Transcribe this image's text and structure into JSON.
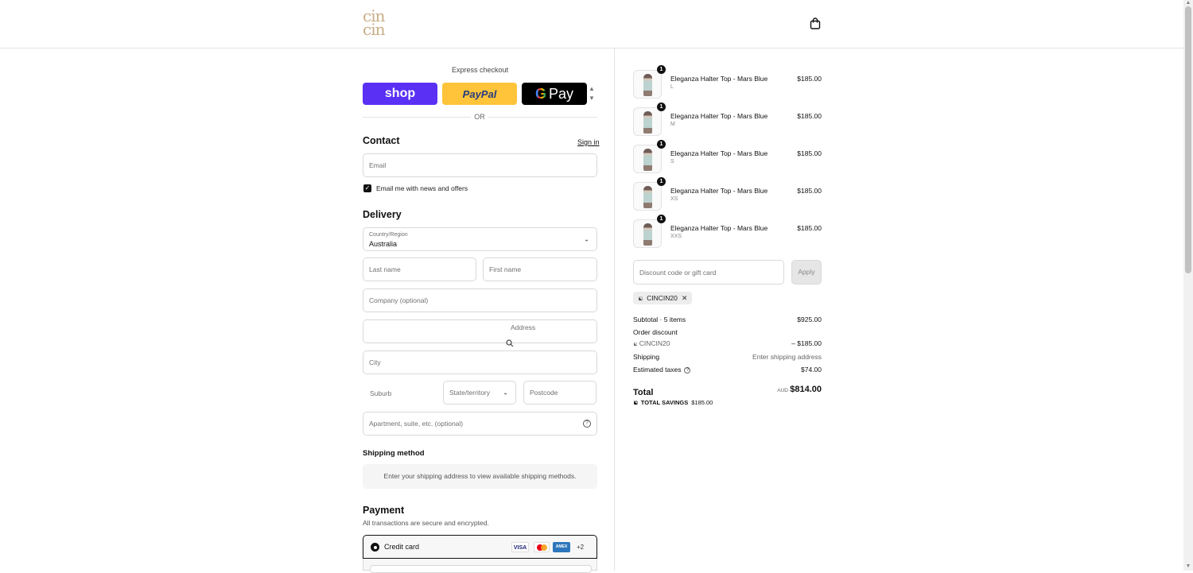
{
  "header": {
    "logo_text": "cin cin",
    "cart_icon": "shopping-bag-icon"
  },
  "express": {
    "title": "Express checkout",
    "shop_label": "shop",
    "paypal_label": "PayPal",
    "gpay_g": "G",
    "gpay_label": "Pay",
    "or_label": "OR"
  },
  "contact": {
    "title": "Contact",
    "sign_in": "Sign in",
    "email_placeholder": "Email",
    "news_checked": true,
    "news_label": "Email me with news and offers"
  },
  "delivery": {
    "title": "Delivery",
    "country_label": "Country/Region",
    "country_value": "Australia",
    "last_name": "Last name",
    "first_name": "First name",
    "company": "Company (optional)",
    "address": "Address",
    "city": "City",
    "suburb": "Suburb",
    "state": "State/territory",
    "postcode": "Postcode",
    "apartment": "Apartment, suite, etc. (optional)"
  },
  "shipping": {
    "title": "Shipping method",
    "message": "Enter your shipping address to view available shipping methods."
  },
  "payment": {
    "title": "Payment",
    "subtitle": "All transactions are secure and encrypted.",
    "method_label": "Credit card",
    "visa": "VISA",
    "amex": "AMEX",
    "more_cards": "+2"
  },
  "order": {
    "items": [
      {
        "name": "Eleganza Halter Top - Mars Blue",
        "variant": "L",
        "price": "$185.00",
        "qty": "1"
      },
      {
        "name": "Eleganza Halter Top - Mars Blue",
        "variant": "M",
        "price": "$185.00",
        "qty": "1"
      },
      {
        "name": "Eleganza Halter Top - Mars Blue",
        "variant": "S",
        "price": "$185.00",
        "qty": "1"
      },
      {
        "name": "Eleganza Halter Top - Mars Blue",
        "variant": "XS",
        "price": "$185.00",
        "qty": "1"
      },
      {
        "name": "Eleganza Halter Top - Mars Blue",
        "variant": "XXS",
        "price": "$185.00",
        "qty": "1"
      }
    ],
    "discount_placeholder": "Discount code or gift card",
    "apply_label": "Apply",
    "applied_code": "CINCIN20",
    "subtotal_label": "Subtotal · 5 items",
    "subtotal_value": "$925.00",
    "order_discount_label": "Order discount",
    "discount_code": "CINCIN20",
    "discount_value": "– $185.00",
    "shipping_label": "Shipping",
    "shipping_value": "Enter shipping address",
    "taxes_label": "Estimated taxes",
    "taxes_value": "$74.00",
    "total_label": "Total",
    "currency": "AUD",
    "total_value": "$814.00",
    "savings_label": "TOTAL SAVINGS",
    "savings_value": "$185.00"
  },
  "colors": {
    "shop": "#5a31f4",
    "paypal": "#ffc439",
    "gpay": "#000000",
    "logo": "#c9ad86"
  }
}
